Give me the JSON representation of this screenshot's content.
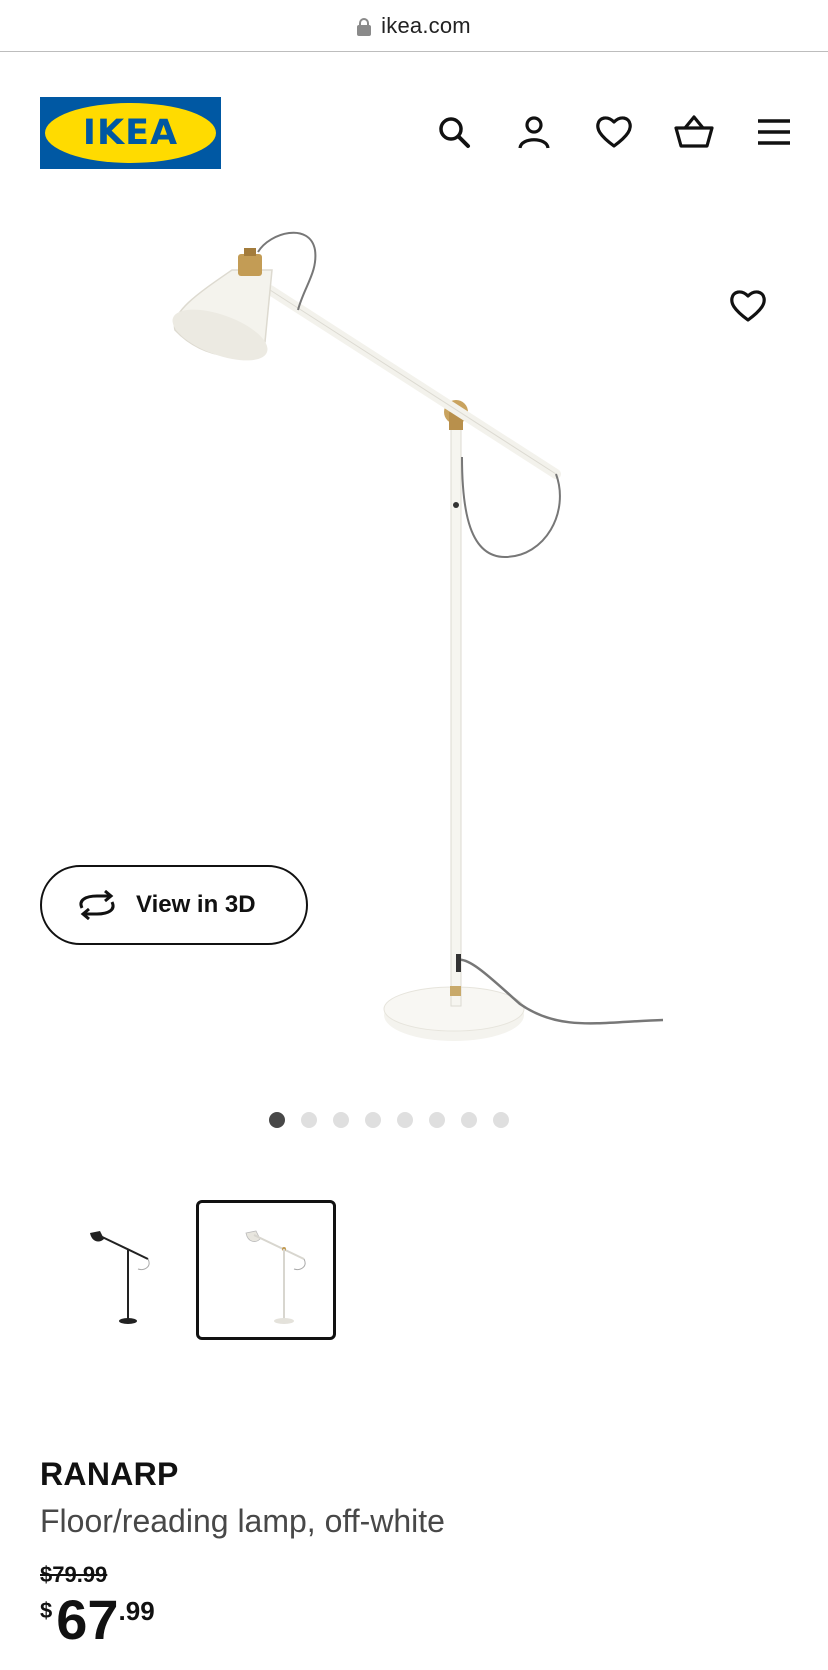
{
  "browser": {
    "url": "ikea.com",
    "lock_icon": "lock-icon"
  },
  "header": {
    "logo_text": "IKEA",
    "logo_colors": {
      "blue": "#0058a3",
      "yellow": "#ffdb00"
    },
    "icons": [
      "search-icon",
      "account-icon",
      "favorites-icon",
      "cart-icon",
      "menu-icon"
    ]
  },
  "gallery": {
    "image": "floor-reading-lamp-off-white",
    "favorite_icon": "heart-icon",
    "view3d_label": "View in 3D",
    "image_count": 8,
    "active_index": 0
  },
  "thumbnails": [
    {
      "name": "black-lamp-thumbnail",
      "selected": false
    },
    {
      "name": "off-white-lamp-thumbnail",
      "selected": true
    }
  ],
  "product": {
    "name": "RANARP",
    "description": "Floor/reading lamp, off-white",
    "old_price": "$79.99",
    "price_currency": "$",
    "price_integer": "67",
    "price_decimal": ".99"
  }
}
